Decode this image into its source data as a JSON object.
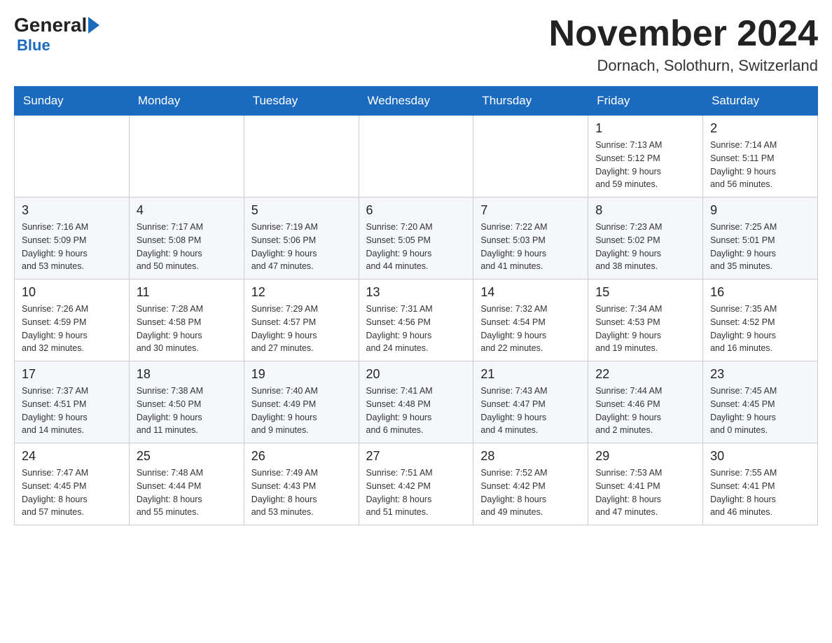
{
  "logo": {
    "general": "General",
    "blue": "Blue"
  },
  "title": "November 2024",
  "location": "Dornach, Solothurn, Switzerland",
  "weekdays": [
    "Sunday",
    "Monday",
    "Tuesday",
    "Wednesday",
    "Thursday",
    "Friday",
    "Saturday"
  ],
  "weeks": [
    [
      {
        "day": "",
        "info": ""
      },
      {
        "day": "",
        "info": ""
      },
      {
        "day": "",
        "info": ""
      },
      {
        "day": "",
        "info": ""
      },
      {
        "day": "",
        "info": ""
      },
      {
        "day": "1",
        "info": "Sunrise: 7:13 AM\nSunset: 5:12 PM\nDaylight: 9 hours\nand 59 minutes."
      },
      {
        "day": "2",
        "info": "Sunrise: 7:14 AM\nSunset: 5:11 PM\nDaylight: 9 hours\nand 56 minutes."
      }
    ],
    [
      {
        "day": "3",
        "info": "Sunrise: 7:16 AM\nSunset: 5:09 PM\nDaylight: 9 hours\nand 53 minutes."
      },
      {
        "day": "4",
        "info": "Sunrise: 7:17 AM\nSunset: 5:08 PM\nDaylight: 9 hours\nand 50 minutes."
      },
      {
        "day": "5",
        "info": "Sunrise: 7:19 AM\nSunset: 5:06 PM\nDaylight: 9 hours\nand 47 minutes."
      },
      {
        "day": "6",
        "info": "Sunrise: 7:20 AM\nSunset: 5:05 PM\nDaylight: 9 hours\nand 44 minutes."
      },
      {
        "day": "7",
        "info": "Sunrise: 7:22 AM\nSunset: 5:03 PM\nDaylight: 9 hours\nand 41 minutes."
      },
      {
        "day": "8",
        "info": "Sunrise: 7:23 AM\nSunset: 5:02 PM\nDaylight: 9 hours\nand 38 minutes."
      },
      {
        "day": "9",
        "info": "Sunrise: 7:25 AM\nSunset: 5:01 PM\nDaylight: 9 hours\nand 35 minutes."
      }
    ],
    [
      {
        "day": "10",
        "info": "Sunrise: 7:26 AM\nSunset: 4:59 PM\nDaylight: 9 hours\nand 32 minutes."
      },
      {
        "day": "11",
        "info": "Sunrise: 7:28 AM\nSunset: 4:58 PM\nDaylight: 9 hours\nand 30 minutes."
      },
      {
        "day": "12",
        "info": "Sunrise: 7:29 AM\nSunset: 4:57 PM\nDaylight: 9 hours\nand 27 minutes."
      },
      {
        "day": "13",
        "info": "Sunrise: 7:31 AM\nSunset: 4:56 PM\nDaylight: 9 hours\nand 24 minutes."
      },
      {
        "day": "14",
        "info": "Sunrise: 7:32 AM\nSunset: 4:54 PM\nDaylight: 9 hours\nand 22 minutes."
      },
      {
        "day": "15",
        "info": "Sunrise: 7:34 AM\nSunset: 4:53 PM\nDaylight: 9 hours\nand 19 minutes."
      },
      {
        "day": "16",
        "info": "Sunrise: 7:35 AM\nSunset: 4:52 PM\nDaylight: 9 hours\nand 16 minutes."
      }
    ],
    [
      {
        "day": "17",
        "info": "Sunrise: 7:37 AM\nSunset: 4:51 PM\nDaylight: 9 hours\nand 14 minutes."
      },
      {
        "day": "18",
        "info": "Sunrise: 7:38 AM\nSunset: 4:50 PM\nDaylight: 9 hours\nand 11 minutes."
      },
      {
        "day": "19",
        "info": "Sunrise: 7:40 AM\nSunset: 4:49 PM\nDaylight: 9 hours\nand 9 minutes."
      },
      {
        "day": "20",
        "info": "Sunrise: 7:41 AM\nSunset: 4:48 PM\nDaylight: 9 hours\nand 6 minutes."
      },
      {
        "day": "21",
        "info": "Sunrise: 7:43 AM\nSunset: 4:47 PM\nDaylight: 9 hours\nand 4 minutes."
      },
      {
        "day": "22",
        "info": "Sunrise: 7:44 AM\nSunset: 4:46 PM\nDaylight: 9 hours\nand 2 minutes."
      },
      {
        "day": "23",
        "info": "Sunrise: 7:45 AM\nSunset: 4:45 PM\nDaylight: 9 hours\nand 0 minutes."
      }
    ],
    [
      {
        "day": "24",
        "info": "Sunrise: 7:47 AM\nSunset: 4:45 PM\nDaylight: 8 hours\nand 57 minutes."
      },
      {
        "day": "25",
        "info": "Sunrise: 7:48 AM\nSunset: 4:44 PM\nDaylight: 8 hours\nand 55 minutes."
      },
      {
        "day": "26",
        "info": "Sunrise: 7:49 AM\nSunset: 4:43 PM\nDaylight: 8 hours\nand 53 minutes."
      },
      {
        "day": "27",
        "info": "Sunrise: 7:51 AM\nSunset: 4:42 PM\nDaylight: 8 hours\nand 51 minutes."
      },
      {
        "day": "28",
        "info": "Sunrise: 7:52 AM\nSunset: 4:42 PM\nDaylight: 8 hours\nand 49 minutes."
      },
      {
        "day": "29",
        "info": "Sunrise: 7:53 AM\nSunset: 4:41 PM\nDaylight: 8 hours\nand 47 minutes."
      },
      {
        "day": "30",
        "info": "Sunrise: 7:55 AM\nSunset: 4:41 PM\nDaylight: 8 hours\nand 46 minutes."
      }
    ]
  ]
}
